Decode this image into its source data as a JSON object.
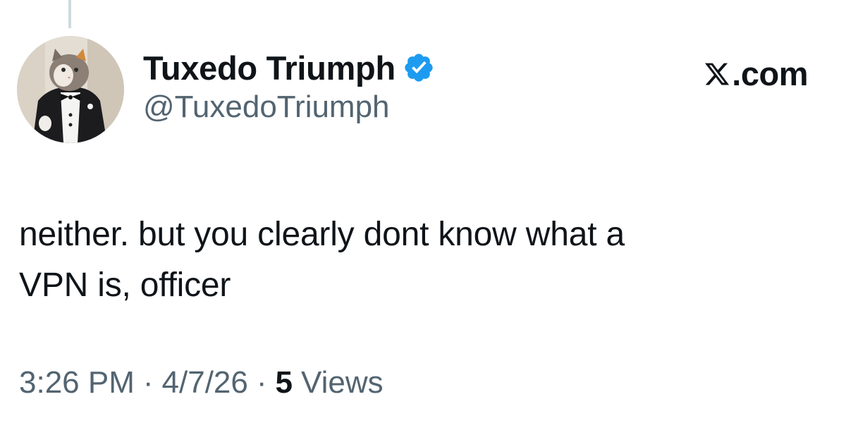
{
  "tweet": {
    "author": {
      "display_name": "Tuxedo Triumph",
      "handle": "@TuxedoTriumph",
      "verified": true,
      "verified_color": "#1d9bf0",
      "avatar_icon": "cat-in-tuxedo-avatar"
    },
    "brand_label": ".com",
    "brand_icon": "x-logo-icon",
    "text": "neither. but you clearly dont know what a\nVPN is, officer",
    "time": "3:26 PM",
    "date": "4/7/26",
    "separator": "·",
    "views_count": "5",
    "views_label": "Views"
  },
  "colors": {
    "text_primary": "#0f1419",
    "text_secondary": "#536471",
    "thread_line": "#cfd9de"
  }
}
